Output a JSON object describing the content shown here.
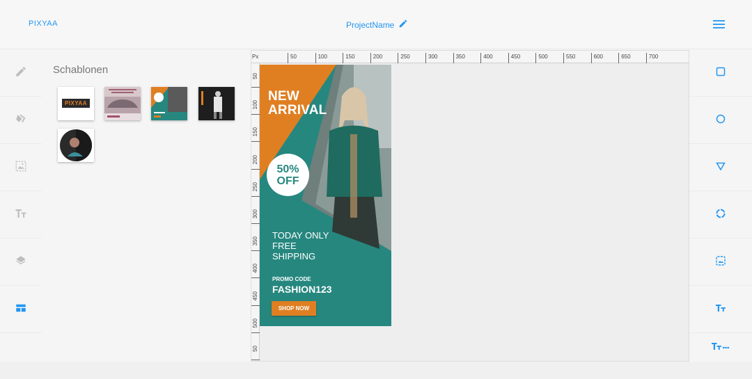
{
  "header": {
    "brand": "PIXYAA",
    "project_name": "ProjectName"
  },
  "panel": {
    "title": "Schablonen",
    "templates": [
      {
        "name": "pixyaa-logo",
        "label": "PIXYAA"
      },
      {
        "name": "car-banner"
      },
      {
        "name": "fashion-ad"
      },
      {
        "name": "bw-fashion"
      },
      {
        "name": "round-portrait"
      }
    ]
  },
  "ruler": {
    "unit": "Px",
    "top_marks": [
      "50",
      "100",
      "150",
      "200",
      "250",
      "300",
      "350",
      "400",
      "450",
      "500",
      "550",
      "600",
      "650",
      "700"
    ],
    "left_marks": [
      "50",
      "100",
      "150",
      "200",
      "250",
      "300",
      "350",
      "400",
      "450",
      "500",
      "50"
    ]
  },
  "ad": {
    "headline_line1": "NEW",
    "headline_line2": "ARRIVAL",
    "badge_line1": "50%",
    "badge_line2": "OFF",
    "offer_line1": "TODAY ONLY",
    "offer_line2": "FREE",
    "offer_line3": "SHIPPING",
    "promo_label": "PROMO CODE",
    "promo_code": "FASHION123",
    "cta": "SHOP NOW",
    "colors": {
      "orange": "#e07f22",
      "teal": "#26877f"
    }
  },
  "left_rail": [
    "pencil-icon",
    "fill-icon",
    "image-icon",
    "text-icon",
    "layers-icon",
    "templates-icon"
  ],
  "tools": [
    "square-icon",
    "circle-icon",
    "triangle-icon",
    "ring-icon",
    "image-frame-icon",
    "text-size-icon",
    "text-spacing-icon"
  ],
  "accent": "#2196f3"
}
